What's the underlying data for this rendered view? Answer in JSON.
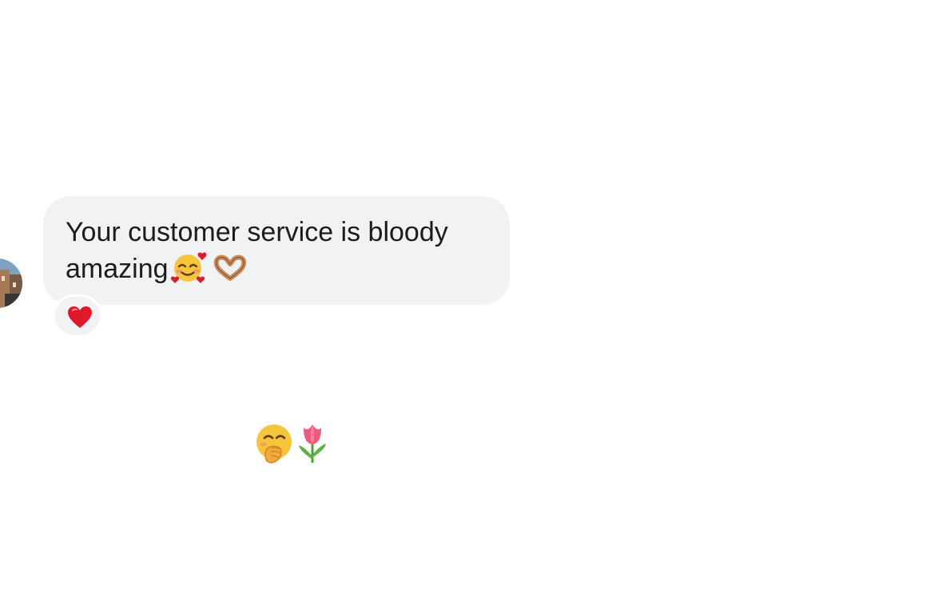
{
  "message": {
    "text": "Your customer service is bloody amazing",
    "emojis": [
      "smiling-face-with-hearts-icon",
      "heart-hands-icon"
    ]
  },
  "reaction": {
    "emoji": "red-heart-icon",
    "color": "#e0192a"
  },
  "reply": {
    "emojis": [
      "face-with-hand-over-mouth-icon",
      "tulip-icon"
    ]
  },
  "colors": {
    "bubble": "#f1f2f4",
    "text": "#1c1c1e",
    "background": "#ffffff"
  }
}
